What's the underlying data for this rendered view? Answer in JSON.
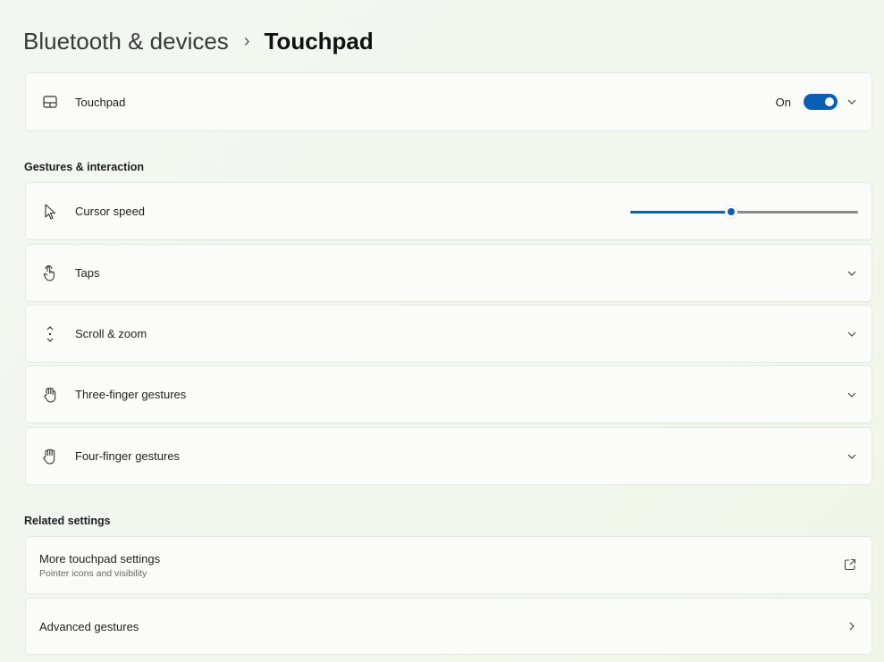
{
  "breadcrumb": {
    "parent": "Bluetooth & devices",
    "separator": "›",
    "current": "Touchpad"
  },
  "touchpad_card": {
    "icon": "touchpad-icon",
    "label": "Touchpad",
    "toggle_state_text": "On",
    "toggle_on": true
  },
  "gestures_section": {
    "title": "Gestures & interaction",
    "cursor_speed": {
      "icon": "cursor-icon",
      "label": "Cursor speed",
      "slider_fraction": 0.45
    },
    "items": [
      {
        "icon": "tap-icon",
        "label": "Taps"
      },
      {
        "icon": "scroll-icon",
        "label": "Scroll & zoom"
      },
      {
        "icon": "three-finger-icon",
        "label": "Three-finger gestures"
      },
      {
        "icon": "four-finger-icon",
        "label": "Four-finger gestures"
      }
    ]
  },
  "related_section": {
    "title": "Related settings",
    "more_touchpad": {
      "label": "More touchpad settings",
      "sublabel": "Pointer icons and visibility",
      "icon": "external-link-icon"
    },
    "advanced_gestures": {
      "label": "Advanced gestures",
      "icon": "chevron-right-icon"
    }
  },
  "colors": {
    "accent": "#0a5fb4",
    "background": "#f3f6ee",
    "card": "#fbfcf9"
  }
}
